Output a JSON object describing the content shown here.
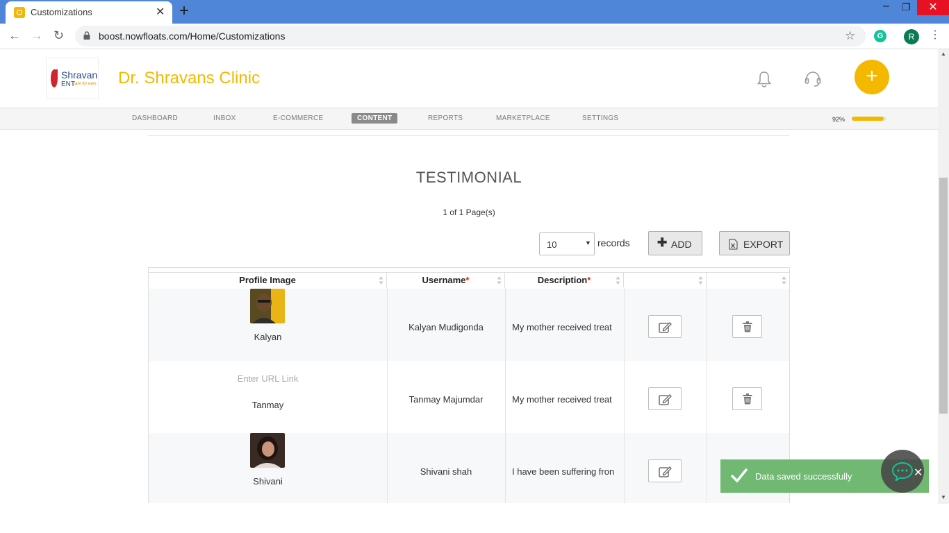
{
  "browser": {
    "tab_title": "Customizations",
    "url": "boost.nowfloats.com/Home/Customizations",
    "profile_initial": "R",
    "extension_letter": "G"
  },
  "header": {
    "logo_top": "Shravan",
    "logo_bottom": "ENT",
    "logo_tag": "care for ears",
    "clinic_name": "Dr. Shravans Clinic",
    "add_symbol": "+"
  },
  "nav": {
    "items": [
      "DASHBOARD",
      "INBOX",
      "E-COMMERCE",
      "CONTENT",
      "REPORTS",
      "MARKETPLACE",
      "SETTINGS"
    ],
    "active": "CONTENT",
    "progress_text": "92%",
    "progress_value": 0.92
  },
  "page": {
    "heading": "TESTIMONIAL",
    "count_text": "1 of 1 Page(s)",
    "records_value": "10",
    "records_label": "records",
    "add_label": "ADD",
    "export_label": "EXPORT"
  },
  "table": {
    "headers": {
      "profile_image": "Profile Image",
      "username": "Username",
      "description": "Description",
      "required_marker": "*"
    },
    "rows": [
      {
        "name": "Kalyan",
        "username": "Kalyan Mudigonda",
        "description": "My mother received treat",
        "photo": "kalyan"
      },
      {
        "name": "Tanmay",
        "username": "Tanmay Majumdar",
        "description": "My mother received treat",
        "url_placeholder": "Enter URL Link"
      },
      {
        "name": "Shivani",
        "username": "Shivani shah",
        "description": "I have been suffering fron",
        "photo": "shivani"
      }
    ]
  },
  "toast": {
    "message": "Data saved successfully",
    "color": "#71b873"
  },
  "colors": {
    "brand": "#f5b800",
    "chrome_blue": "#4f86d8"
  }
}
